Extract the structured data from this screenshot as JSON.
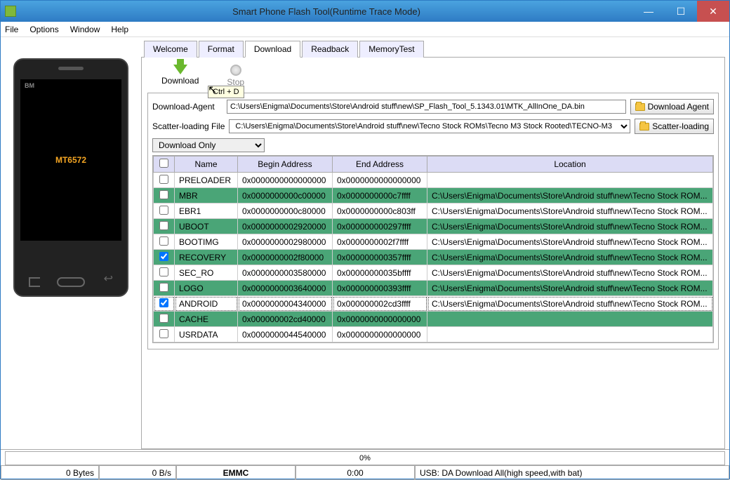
{
  "window": {
    "title": "Smart Phone Flash Tool(Runtime Trace Mode)"
  },
  "menu": [
    "File",
    "Options",
    "Window",
    "Help"
  ],
  "phone": {
    "chip": "MT6572",
    "bm": "BM"
  },
  "tabs": [
    "Welcome",
    "Format",
    "Download",
    "Readback",
    "MemoryTest"
  ],
  "active_tab": "Download",
  "toolbar": {
    "download": "Download",
    "stop": "Stop",
    "tooltip": "Ctrl + D"
  },
  "paths": {
    "da_label": "Download-Agent",
    "da_value": "C:\\Users\\Enigma\\Documents\\Store\\Android stuff\\new\\SP_Flash_Tool_5.1343.01\\MTK_AllInOne_DA.bin",
    "da_btn": "Download Agent",
    "scatter_label": "Scatter-loading File",
    "scatter_value": "C:\\Users\\Enigma\\Documents\\Store\\Android stuff\\new\\Tecno Stock ROMs\\Tecno M3 Stock Rooted\\TECNO-M3",
    "scatter_btn": "Scatter-loading"
  },
  "mode": "Download Only",
  "columns": {
    "name": "Name",
    "begin": "Begin Address",
    "end": "End Address",
    "location": "Location"
  },
  "rows": [
    {
      "chk": false,
      "green": false,
      "name": "PRELOADER",
      "begin": "0x0000000000000000",
      "end": "0x0000000000000000",
      "loc": ""
    },
    {
      "chk": false,
      "green": true,
      "name": "MBR",
      "begin": "0x0000000000c00000",
      "end": "0x0000000000c7ffff",
      "loc": "C:\\Users\\Enigma\\Documents\\Store\\Android stuff\\new\\Tecno Stock ROM..."
    },
    {
      "chk": false,
      "green": false,
      "name": "EBR1",
      "begin": "0x0000000000c80000",
      "end": "0x0000000000c803ff",
      "loc": "C:\\Users\\Enigma\\Documents\\Store\\Android stuff\\new\\Tecno Stock ROM..."
    },
    {
      "chk": false,
      "green": true,
      "name": "UBOOT",
      "begin": "0x0000000002920000",
      "end": "0x000000000297ffff",
      "loc": "C:\\Users\\Enigma\\Documents\\Store\\Android stuff\\new\\Tecno Stock ROM..."
    },
    {
      "chk": false,
      "green": false,
      "name": "BOOTIMG",
      "begin": "0x0000000002980000",
      "end": "0x0000000002f7ffff",
      "loc": "C:\\Users\\Enigma\\Documents\\Store\\Android stuff\\new\\Tecno Stock ROM..."
    },
    {
      "chk": true,
      "green": true,
      "name": "RECOVERY",
      "begin": "0x0000000002f80000",
      "end": "0x000000000357ffff",
      "loc": "C:\\Users\\Enigma\\Documents\\Store\\Android stuff\\new\\Tecno Stock ROM..."
    },
    {
      "chk": false,
      "green": false,
      "name": "SEC_RO",
      "begin": "0x0000000003580000",
      "end": "0x00000000035bffff",
      "loc": "C:\\Users\\Enigma\\Documents\\Store\\Android stuff\\new\\Tecno Stock ROM..."
    },
    {
      "chk": false,
      "green": true,
      "name": "LOGO",
      "begin": "0x0000000003640000",
      "end": "0x000000000393ffff",
      "loc": "C:\\Users\\Enigma\\Documents\\Store\\Android stuff\\new\\Tecno Stock ROM..."
    },
    {
      "chk": true,
      "green": false,
      "sel": true,
      "name": "ANDROID",
      "begin": "0x0000000004340000",
      "end": "0x000000002cd3ffff",
      "loc": "C:\\Users\\Enigma\\Documents\\Store\\Android stuff\\new\\Tecno Stock ROM..."
    },
    {
      "chk": false,
      "green": true,
      "name": "CACHE",
      "begin": "0x000000002cd40000",
      "end": "0x0000000000000000",
      "loc": ""
    },
    {
      "chk": false,
      "green": false,
      "name": "USRDATA",
      "begin": "0x0000000044540000",
      "end": "0x0000000000000000",
      "loc": ""
    }
  ],
  "status": {
    "progress": "0%",
    "bytes": "0 Bytes",
    "speed": "0 B/s",
    "storage": "EMMC",
    "time": "0:00",
    "usb": "USB: DA Download All(high speed,with bat)"
  }
}
